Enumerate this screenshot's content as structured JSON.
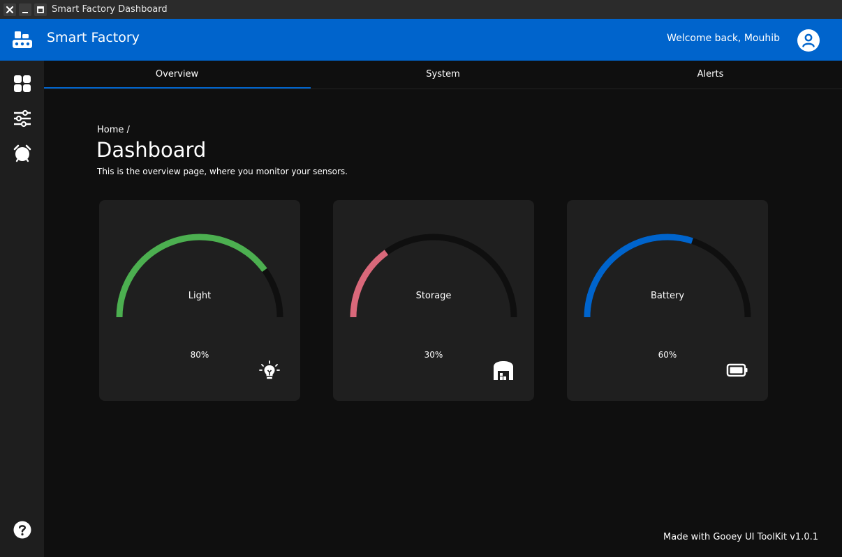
{
  "window": {
    "title": "Smart Factory Dashboard"
  },
  "header": {
    "app_title": "Smart Factory",
    "welcome": "Welcome back, Mouhib",
    "brand_color": "#0064cc"
  },
  "sidebar": {
    "items": [
      {
        "icon": "dashboard-grid-icon"
      },
      {
        "icon": "sliders-icon"
      },
      {
        "icon": "alarm-icon"
      }
    ],
    "help_icon": "help-icon"
  },
  "tabs": [
    {
      "label": "Overview",
      "active": true
    },
    {
      "label": "System",
      "active": false
    },
    {
      "label": "Alerts",
      "active": false
    }
  ],
  "main": {
    "breadcrumb": "Home /",
    "title": "Dashboard",
    "subtitle": "This is the overview page, where you monitor your sensors."
  },
  "cards": [
    {
      "label": "Light",
      "value_text": "80%",
      "value": 0.8,
      "color": "#4caf50",
      "icon": "lightbulb-icon"
    },
    {
      "label": "Storage",
      "value_text": "30%",
      "value": 0.3,
      "color": "#d9687a",
      "icon": "warehouse-icon"
    },
    {
      "label": "Battery",
      "value_text": "60%",
      "value": 0.6,
      "color": "#0064cc",
      "icon": "battery-icon"
    }
  ],
  "footer": {
    "text": "Made with Gooey UI ToolKit v1.0.1"
  }
}
